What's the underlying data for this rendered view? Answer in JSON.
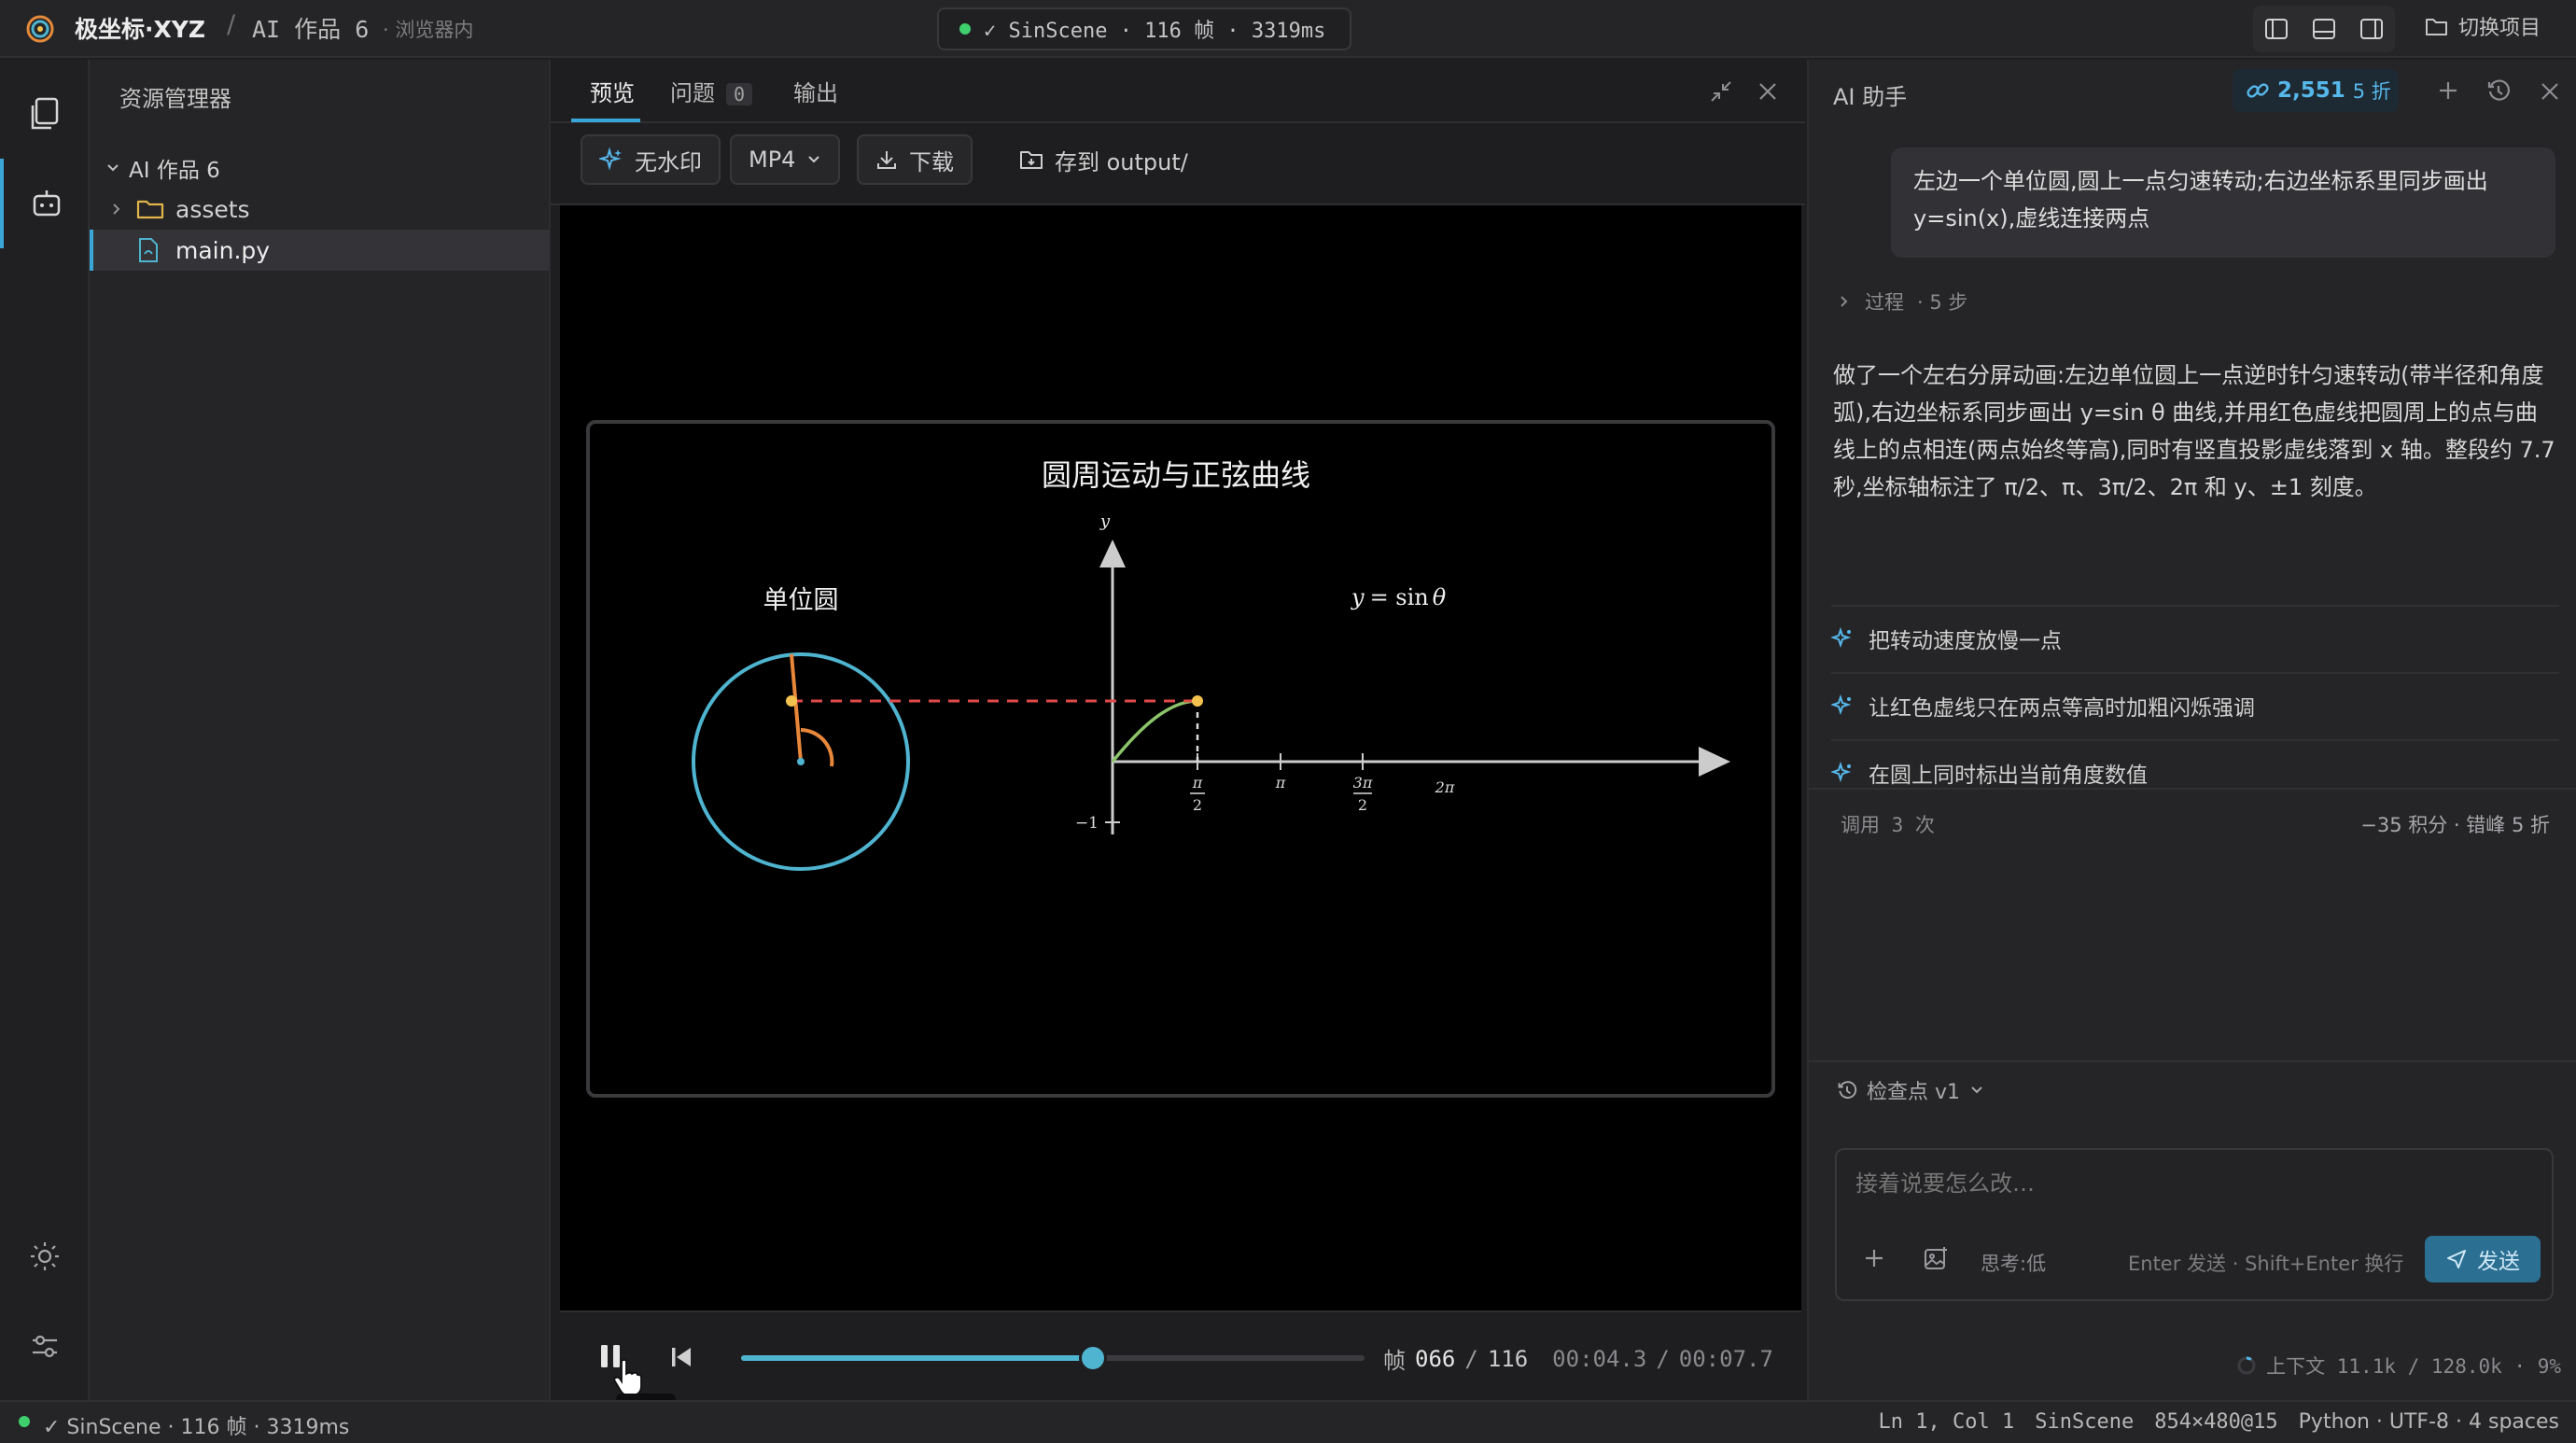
{
  "topbar": {
    "app_name": "极坐标·XYZ",
    "separator": "/",
    "project_name": "AI 作品 6",
    "env_label": "· 浏览器内",
    "status": "✓ SinScene · 116 帧 · 3319ms",
    "switch_project": "切换项目"
  },
  "explorer": {
    "title": "资源管理器",
    "root": "AI 作品 6",
    "items": [
      "assets",
      "main.py"
    ],
    "selected": "main.py"
  },
  "center": {
    "tabs": [
      {
        "label": "预览"
      },
      {
        "label": "问题",
        "count": "0"
      },
      {
        "label": "输出"
      }
    ],
    "toolbar": {
      "watermark": "无水印",
      "format": "MP4",
      "download": "下载",
      "save": "存到 output/"
    }
  },
  "scene": {
    "title": "圆周运动与正弦曲线",
    "circle_label": "单位圆",
    "formula_y": "y",
    "formula_eq": "= sin",
    "formula_theta": "θ",
    "y_axis": "y",
    "tick_neg1": "−1",
    "tick_pi_half_num": "π",
    "tick_pi_half_den": "2",
    "tick_pi": "π",
    "tick_3pi_half_num": "3π",
    "tick_3pi_half_den": "2",
    "tick_2pi": "2π",
    "colors": {
      "circle": "#4fb4cf",
      "radius": "#e8873a",
      "dot": "#f2c14e",
      "dashed_link": "#e04a4a",
      "sine_curve": "#8cc46a",
      "axis": "#cccccc"
    },
    "angle_shown_fraction_of_half_pi": 1.0
  },
  "player": {
    "frame_label": "帧",
    "frame_current": "066",
    "frame_sep": "/",
    "frame_total": "116",
    "time_current": "00:04.3",
    "time_total": "00:07.7",
    "progress": 0.565,
    "tooltip": "暂停"
  },
  "assistant": {
    "title": "AI 助手",
    "credits": "2,551",
    "discount": "5 折",
    "user_message": "左边一个单位圆,圆上一点匀速转动;右边坐标系里同步画出 y=sin(x),虚线连接两点",
    "process_label": "过程",
    "process_steps": "· 5 步",
    "answer": "做了一个左右分屏动画:左边单位圆上一点逆时针匀速转动(带半径和角度弧),右边坐标系同步画出 y=sin θ 曲线,并用红色虚线把圆周上的点与曲线上的点相连(两点始终等高),同时有竖直投影虚线落到 x 轴。整段约 7.7 秒,坐标轴标注了 π/2、π、3π/2、2π 和 y、±1 刻度。",
    "suggestions": [
      "把转动速度放慢一点",
      "让红色虚线只在两点等高时加粗闪烁强调",
      "在圆上同时标出当前角度数值"
    ],
    "usage_left": "调用 3 次",
    "usage_right": "−35 积分 · 错峰 5 折",
    "checkpoint": "检查点 v1",
    "input_placeholder": "接着说要怎么改…",
    "thinking": "思考:低",
    "hint": "Enter 发送 · Shift+Enter 换行",
    "send": "发送",
    "context": "上下文 11.1k / 128.0k · 9%"
  },
  "statusbar": {
    "left": "✓ SinScene · 116 帧 · 3319ms",
    "position": "Ln 1, Col 1",
    "scene": "SinScene",
    "resolution": "854×480@15",
    "lang": "Python · UTF-8 · 4 spaces"
  }
}
